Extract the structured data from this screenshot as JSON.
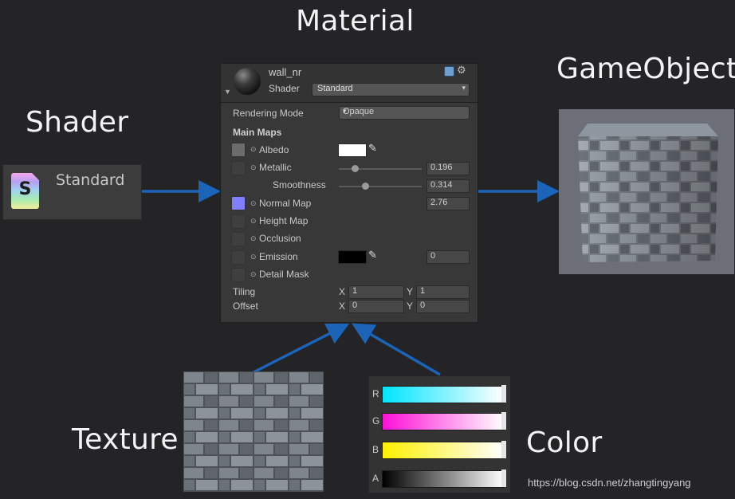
{
  "titles": {
    "material": "Material",
    "shader": "Shader",
    "gameobject": "GameObject",
    "texture": "Texture",
    "color": "Color"
  },
  "shader_chip": {
    "label": "Standard",
    "icon_letter": "S"
  },
  "inspector": {
    "material_name": "wall_nr",
    "shader_label": "Shader",
    "shader_value": "Standard",
    "rendering_mode_label": "Rendering Mode",
    "rendering_mode_value": "Opaque",
    "main_maps_title": "Main Maps",
    "rows": {
      "albedo": "Albedo",
      "metallic": "Metallic",
      "metallic_value": "0.196",
      "smoothness": "Smoothness",
      "smoothness_value": "0.314",
      "normal_map": "Normal Map",
      "normal_value": "2.76",
      "height_map": "Height Map",
      "occlusion": "Occlusion",
      "emission": "Emission",
      "emission_value": "0",
      "detail_mask": "Detail Mask"
    },
    "tiling": {
      "label": "Tiling",
      "x_label": "X",
      "x": "1",
      "y_label": "Y",
      "y": "1"
    },
    "offset": {
      "label": "Offset",
      "x_label": "X",
      "x": "0",
      "y_label": "Y",
      "y": "0"
    },
    "slider_levels": {
      "metallic": 0.196,
      "smoothness": 0.314
    },
    "colors": {
      "albedo_swatch": "#ffffff",
      "emission_swatch": "#000000",
      "normal_slot": "#8080ff"
    }
  },
  "color_channels": [
    {
      "label": "R",
      "color": "#00e5ff"
    },
    {
      "label": "G",
      "color": "#ff10d8"
    },
    {
      "label": "B",
      "color": "#fff000"
    },
    {
      "label": "A",
      "color": "#000000"
    }
  ],
  "icons": [
    "file-shader-icon",
    "material-sphere-icon",
    "help-book-icon",
    "gear-icon",
    "color-picker-icon",
    "radio-icon"
  ],
  "arrow_color": "#1c64b8",
  "watermark": "https://blog.csdn.net/zhangtingyang"
}
